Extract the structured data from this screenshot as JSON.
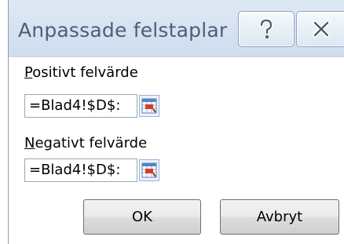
{
  "dialog": {
    "title": "Anpassade felstaplar",
    "help_glyph": "?",
    "close_glyph": "✕"
  },
  "positive": {
    "label_accel": "P",
    "label_rest": "ositivt felvärde",
    "value": "=Blad4!$D$:"
  },
  "negative": {
    "label_accel": "N",
    "label_rest": "egativt felvärde",
    "value": "=Blad4!$D$:"
  },
  "buttons": {
    "ok": "OK",
    "cancel": "Avbryt"
  },
  "icons": {
    "help": "help-icon",
    "close": "close-icon",
    "collapse": "range-collapse-icon"
  }
}
